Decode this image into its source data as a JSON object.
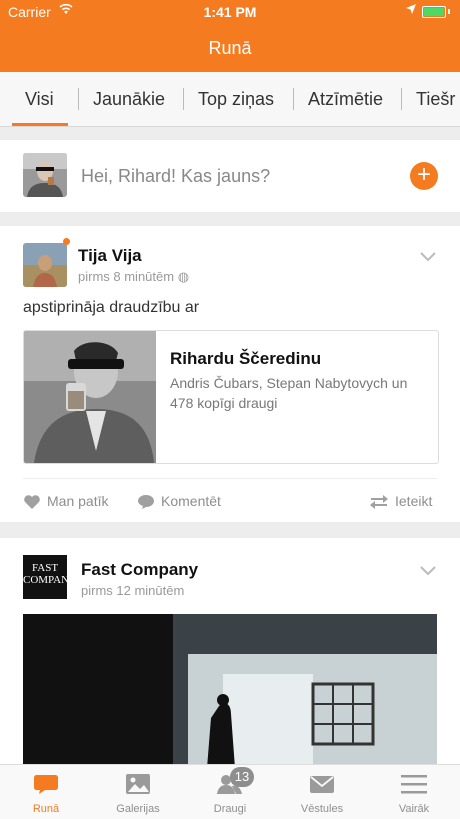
{
  "status_bar": {
    "carrier": "Carrier",
    "time": "1:41 PM"
  },
  "header": {
    "title": "Runā"
  },
  "tabs": [
    {
      "label": "Visi",
      "active": true
    },
    {
      "label": "Jaunākie"
    },
    {
      "label": "Top ziņas"
    },
    {
      "label": "Atzīmētie"
    },
    {
      "label": "Tiešr"
    }
  ],
  "compose": {
    "placeholder": "Hei, Rihard! Kas jauns?"
  },
  "post1": {
    "author": "Tija Vija",
    "time": "pirms 8 minūtēm",
    "text": "apstiprināja draudzību ar",
    "shared": {
      "name": "Rihardu Ščeredinu",
      "mutual": "Andris Čubars, Stepan Nabytovych un 478 kopīgi draugi"
    },
    "actions": {
      "like": "Man patīk",
      "comment": "Komentēt",
      "share": "Ieteikt"
    }
  },
  "post2": {
    "author": "Fast Company",
    "time": "pirms 12 minūtēm",
    "logo_text": "FAST COMPANY"
  },
  "bottom_nav": [
    {
      "label": "Runā",
      "icon": "chat-bubble-icon",
      "active": true
    },
    {
      "label": "Galerijas",
      "icon": "gallery-icon"
    },
    {
      "label": "Draugi",
      "icon": "friends-icon",
      "badge": "13"
    },
    {
      "label": "Vēstules",
      "icon": "mail-icon"
    },
    {
      "label": "Vairāk",
      "icon": "menu-icon"
    }
  ],
  "colors": {
    "accent": "#f47b20",
    "inactive": "#8e8e8e"
  }
}
